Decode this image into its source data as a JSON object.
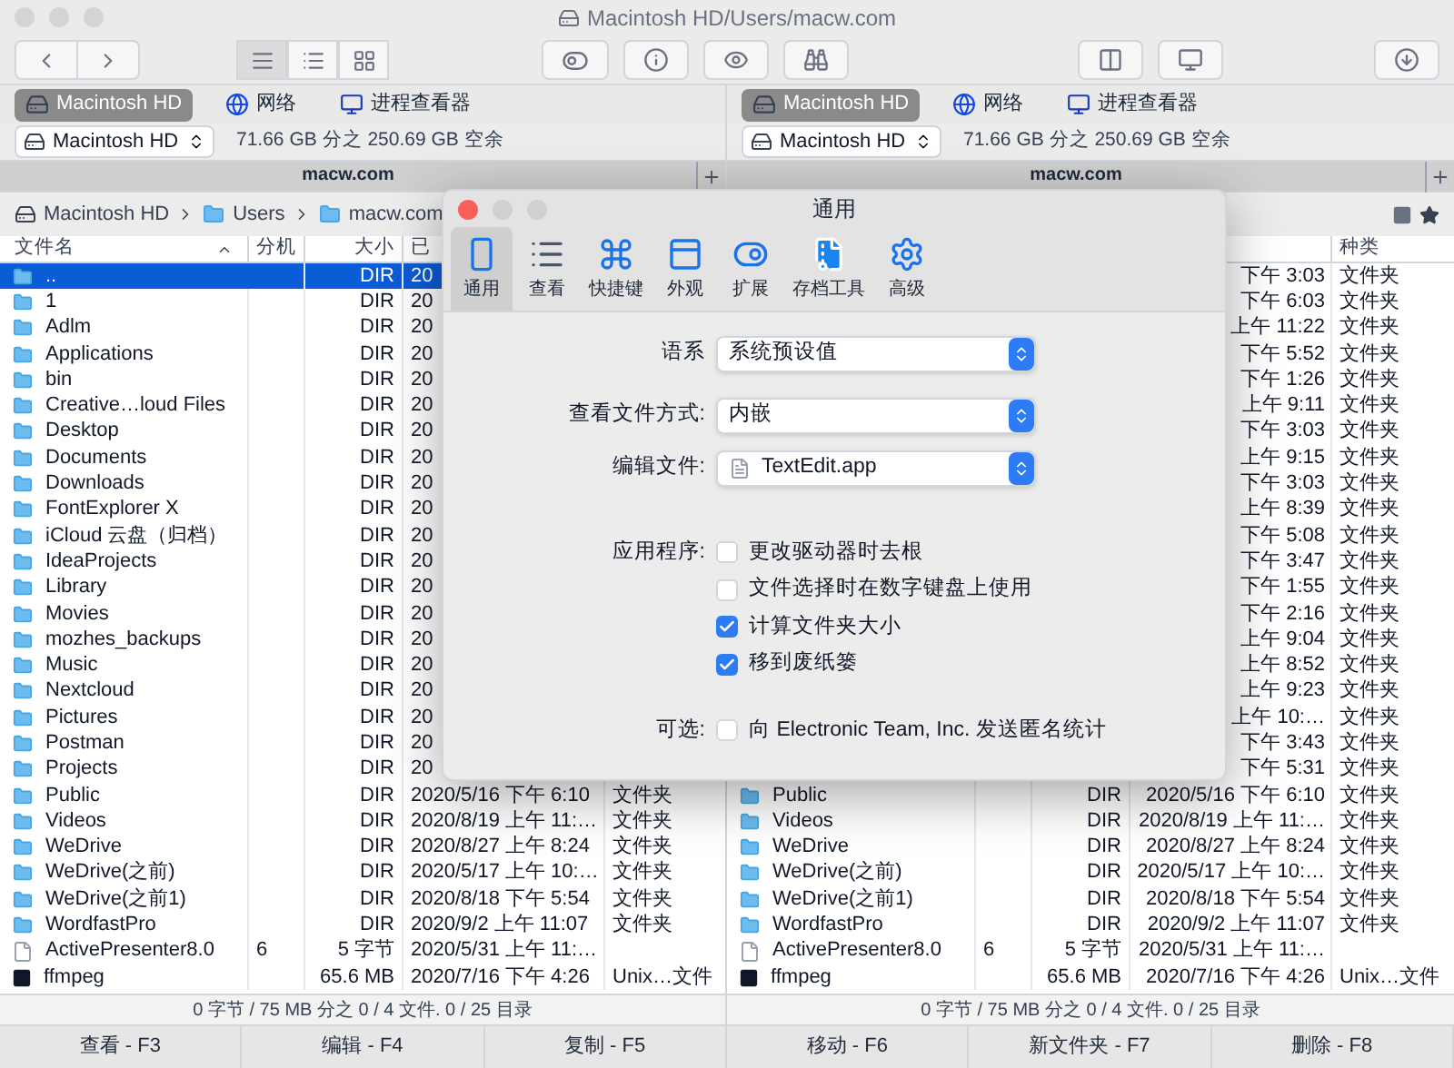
{
  "window": {
    "title": "Macintosh HD/Users/macw.com"
  },
  "view_modes": [
    {
      "kind": "list",
      "selected": true
    },
    {
      "kind": "details",
      "selected": false
    },
    {
      "kind": "grid",
      "selected": false
    }
  ],
  "panes": [
    {
      "favorites": [
        {
          "kind": "drive",
          "label": "Macintosh HD",
          "selected": true
        },
        {
          "kind": "network",
          "label": "网络",
          "selected": false
        },
        {
          "kind": "monitor",
          "label": "进程查看器",
          "selected": false
        }
      ],
      "drive": {
        "name": "Macintosh HD",
        "free": "71.66 GB 分之 250.69 GB 空余"
      },
      "tab": "macw.com",
      "path": [
        {
          "kind": "drive",
          "label": "Macintosh HD"
        },
        {
          "kind": "folder",
          "label": "Users"
        },
        {
          "kind": "folder",
          "label": "macw.com"
        }
      ],
      "columns": {
        "name": "文件名",
        "ext": "分机",
        "size": "大小",
        "date": "已"
      },
      "rows": [
        {
          "kind": "folder",
          "name": "..",
          "size": "DIR",
          "date": "20",
          "selected": true
        },
        {
          "kind": "folder",
          "name": "1",
          "size": "DIR",
          "date": "20",
          "selected": false
        },
        {
          "kind": "folder",
          "name": "Adlm",
          "size": "DIR",
          "date": "20",
          "selected": false
        },
        {
          "kind": "folder",
          "name": "Applications",
          "size": "DIR",
          "date": "20",
          "selected": false
        },
        {
          "kind": "folder",
          "name": "bin",
          "size": "DIR",
          "date": "20",
          "selected": false
        },
        {
          "kind": "folder",
          "name": "Creative…loud Files",
          "size": "DIR",
          "date": "20",
          "selected": false
        },
        {
          "kind": "folder",
          "name": "Desktop",
          "size": "DIR",
          "date": "20",
          "selected": false
        },
        {
          "kind": "folder",
          "name": "Documents",
          "size": "DIR",
          "date": "20",
          "selected": false
        },
        {
          "kind": "folder",
          "name": "Downloads",
          "size": "DIR",
          "date": "20",
          "selected": false
        },
        {
          "kind": "folder",
          "name": "FontExplorer X",
          "size": "DIR",
          "date": "20",
          "selected": false
        },
        {
          "kind": "folder",
          "name": "iCloud 云盘（归档）",
          "size": "DIR",
          "date": "20",
          "selected": false
        },
        {
          "kind": "folder",
          "name": "IdeaProjects",
          "size": "DIR",
          "date": "20",
          "selected": false
        },
        {
          "kind": "folder",
          "name": "Library",
          "size": "DIR",
          "date": "20",
          "selected": false
        },
        {
          "kind": "folder",
          "name": "Movies",
          "size": "DIR",
          "date": "20",
          "selected": false
        },
        {
          "kind": "folder",
          "name": "mozhes_backups",
          "size": "DIR",
          "date": "20",
          "selected": false
        },
        {
          "kind": "folder",
          "name": "Music",
          "size": "DIR",
          "date": "20",
          "selected": false
        },
        {
          "kind": "folder",
          "name": "Nextcloud",
          "size": "DIR",
          "date": "20",
          "selected": false
        },
        {
          "kind": "folder",
          "name": "Pictures",
          "size": "DIR",
          "date": "20",
          "selected": false
        },
        {
          "kind": "folder",
          "name": "Postman",
          "size": "DIR",
          "date": "20",
          "selected": false
        },
        {
          "kind": "folder",
          "name": "Projects",
          "size": "DIR",
          "date": "20",
          "selected": false
        },
        {
          "kind": "folder",
          "name": "Public",
          "size": "DIR",
          "date": "2020/5/16 下午 6:10",
          "category": "文件夹",
          "selected": false
        },
        {
          "kind": "folder",
          "name": "Videos",
          "size": "DIR",
          "date": "2020/8/19 上午 11:…",
          "category": "文件夹",
          "selected": false
        },
        {
          "kind": "folder",
          "name": "WeDrive",
          "size": "DIR",
          "date": "2020/8/27 上午 8:24",
          "category": "文件夹",
          "selected": false
        },
        {
          "kind": "folder",
          "name": "WeDrive(之前)",
          "size": "DIR",
          "date": "2020/5/17 上午 10:…",
          "category": "文件夹",
          "selected": false
        },
        {
          "kind": "folder",
          "name": "WeDrive(之前1)",
          "size": "DIR",
          "date": "2020/8/18 下午 5:54",
          "category": "文件夹",
          "selected": false
        },
        {
          "kind": "folder",
          "name": "WordfastPro",
          "size": "DIR",
          "date": "2020/9/2 上午 11:07",
          "category": "文件夹",
          "selected": false
        },
        {
          "kind": "file",
          "name": "ActivePresenter8.0",
          "ext": "6",
          "size": "5 字节",
          "date": "2020/5/31 上午 11:…",
          "selected": false
        },
        {
          "kind": "exec",
          "name": "ffmpeg",
          "size": "65.6 MB",
          "date": "2020/7/16 下午 4:26",
          "category": "Unix…文件",
          "selected": false
        }
      ],
      "status": "0 字节 / 75 MB 分之 0 / 4 文件. 0 / 25 目录"
    },
    {
      "favorites": [
        {
          "kind": "drive",
          "label": "Macintosh HD",
          "selected": true
        },
        {
          "kind": "network",
          "label": "网络",
          "selected": false
        },
        {
          "kind": "monitor",
          "label": "进程查看器",
          "selected": false
        }
      ],
      "drive": {
        "name": "Macintosh HD",
        "free": "71.66 GB 分之 250.69 GB 空余"
      },
      "tab": "macw.com",
      "columns": {
        "category": "种类"
      },
      "rows": [
        {
          "date": "下午 3:03",
          "category": "文件夹",
          "selected": false
        },
        {
          "date": "下午 6:03",
          "category": "文件夹",
          "selected": false
        },
        {
          "date": "上午 11:22",
          "category": "文件夹",
          "selected": false
        },
        {
          "date": "下午 5:52",
          "category": "文件夹",
          "selected": false
        },
        {
          "date": "下午 1:26",
          "category": "文件夹",
          "selected": false
        },
        {
          "date": "上午 9:11",
          "category": "文件夹",
          "selected": false
        },
        {
          "date": "下午 3:03",
          "category": "文件夹",
          "selected": false
        },
        {
          "date": "上午 9:15",
          "category": "文件夹",
          "selected": false
        },
        {
          "date": "下午 3:03",
          "category": "文件夹",
          "selected": false
        },
        {
          "date": "上午 8:39",
          "category": "文件夹",
          "selected": false
        },
        {
          "date": "下午 5:08",
          "category": "文件夹",
          "selected": false
        },
        {
          "date": "下午 3:47",
          "category": "文件夹",
          "selected": false
        },
        {
          "date": "下午 1:55",
          "category": "文件夹",
          "selected": false
        },
        {
          "date": "下午 2:16",
          "category": "文件夹",
          "selected": false
        },
        {
          "date": "上午 9:04",
          "category": "文件夹",
          "selected": false
        },
        {
          "date": "上午 8:52",
          "category": "文件夹",
          "selected": false
        },
        {
          "date": "上午 9:23",
          "category": "文件夹",
          "selected": false
        },
        {
          "date": "上午 10:…",
          "category": "文件夹",
          "selected": false
        },
        {
          "date": "下午 3:43",
          "category": "文件夹",
          "selected": false
        },
        {
          "date": "下午 5:31",
          "category": "文件夹",
          "selected": false
        },
        {
          "kind": "folder",
          "name": "Public",
          "size": "DIR",
          "date": "2020/5/16 下午 6:10",
          "category": "文件夹",
          "selected": false
        },
        {
          "kind": "folder",
          "name": "Videos",
          "size": "DIR",
          "date": "2020/8/19 上午 11:…",
          "category": "文件夹",
          "selected": false
        },
        {
          "kind": "folder",
          "name": "WeDrive",
          "size": "DIR",
          "date": "2020/8/27 上午 8:24",
          "category": "文件夹",
          "selected": false
        },
        {
          "kind": "folder",
          "name": "WeDrive(之前)",
          "size": "DIR",
          "date": "2020/5/17 上午 10:…",
          "category": "文件夹",
          "selected": false
        },
        {
          "kind": "folder",
          "name": "WeDrive(之前1)",
          "size": "DIR",
          "date": "2020/8/18 下午 5:54",
          "category": "文件夹",
          "selected": false
        },
        {
          "kind": "folder",
          "name": "WordfastPro",
          "size": "DIR",
          "date": "2020/9/2 上午 11:07",
          "category": "文件夹",
          "selected": false
        },
        {
          "kind": "file",
          "name": "ActivePresenter8.0",
          "ext": "6",
          "size": "5 字节",
          "date": "2020/5/31 上午 11:…",
          "selected": false
        },
        {
          "kind": "exec",
          "name": "ffmpeg",
          "size": "65.6 MB",
          "date": "2020/7/16 下午 4:26",
          "category": "Unix…文件",
          "selected": false
        }
      ],
      "status": "0 字节 / 75 MB 分之 0 / 4 文件. 0 / 25 目录"
    }
  ],
  "function_keys": [
    "查看 - F3",
    "编辑 - F4",
    "复制 - F5",
    "移动 - F6",
    "新文件夹 - F7",
    "删除 - F8"
  ],
  "dialog": {
    "title": "通用",
    "tabs": [
      {
        "kind": "general",
        "label": "通用",
        "selected": true
      },
      {
        "kind": "view",
        "label": "查看",
        "selected": false
      },
      {
        "kind": "shortcuts",
        "label": "快捷键",
        "selected": false
      },
      {
        "kind": "appearance",
        "label": "外观",
        "selected": false
      },
      {
        "kind": "extensions",
        "label": "扩展",
        "selected": false
      },
      {
        "kind": "archive",
        "label": "存档工具",
        "selected": false
      },
      {
        "kind": "advanced",
        "label": "高级",
        "selected": false
      }
    ],
    "selects": [
      {
        "label": "语系",
        "value": "系统预设值"
      },
      {
        "label": "查看文件方式:",
        "value": "内嵌"
      },
      {
        "label": "编辑文件:",
        "value": "TextEdit.app",
        "app_icon": true
      }
    ],
    "groups": [
      {
        "label": "应用程序:",
        "options": [
          {
            "label": "更改驱动器时去根",
            "checked": false
          },
          {
            "label": "文件选择时在数字键盘上使用",
            "checked": false
          },
          {
            "label": "计算文件夹大小",
            "checked": true
          },
          {
            "label": "移到废纸篓",
            "checked": true
          }
        ]
      },
      {
        "label": "可选:",
        "options": [
          {
            "label": "向 Electronic Team, Inc. 发送匿名统计",
            "checked": false
          }
        ]
      }
    ]
  }
}
